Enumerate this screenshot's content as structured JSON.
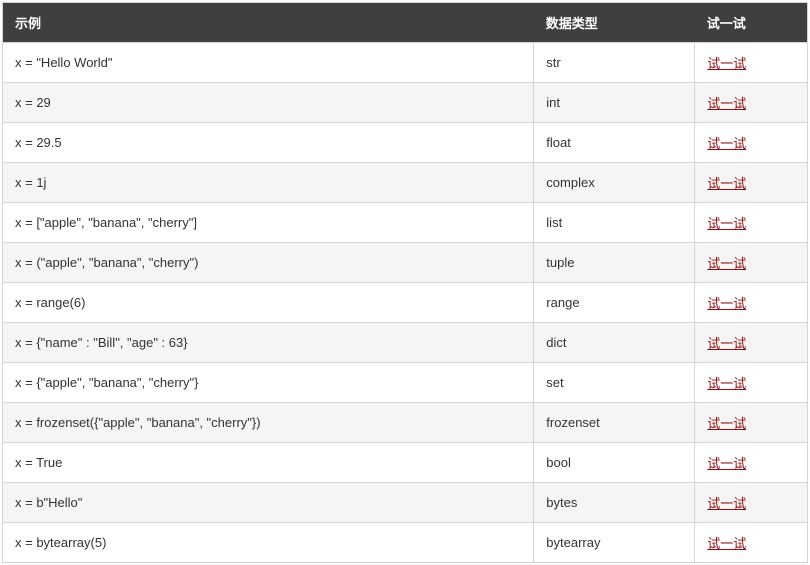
{
  "table": {
    "headers": {
      "example": "示例",
      "dataType": "数据类型",
      "tryIt": "试一试"
    },
    "rows": [
      {
        "example": "x = \"Hello World\"",
        "type": "str",
        "action": "试一试"
      },
      {
        "example": "x = 29",
        "type": "int",
        "action": "试一试"
      },
      {
        "example": "x = 29.5",
        "type": "float",
        "action": "试一试"
      },
      {
        "example": "x = 1j",
        "type": "complex",
        "action": "试一试"
      },
      {
        "example": "x = [\"apple\", \"banana\", \"cherry\"]",
        "type": "list",
        "action": "试一试"
      },
      {
        "example": "x = (\"apple\", \"banana\", \"cherry\")",
        "type": "tuple",
        "action": "试一试"
      },
      {
        "example": "x = range(6)",
        "type": "range",
        "action": "试一试"
      },
      {
        "example": "x = {\"name\" : \"Bill\", \"age\" : 63}",
        "type": "dict",
        "action": "试一试"
      },
      {
        "example": "x = {\"apple\", \"banana\", \"cherry\"}",
        "type": "set",
        "action": "试一试"
      },
      {
        "example": "x = frozenset({\"apple\", \"banana\", \"cherry\"})",
        "type": "frozenset",
        "action": "试一试"
      },
      {
        "example": "x = True",
        "type": "bool",
        "action": "试一试"
      },
      {
        "example": "x = b\"Hello\"",
        "type": "bytes",
        "action": "试一试"
      },
      {
        "example": "x = bytearray(5)",
        "type": "bytearray",
        "action": "试一试"
      }
    ]
  }
}
